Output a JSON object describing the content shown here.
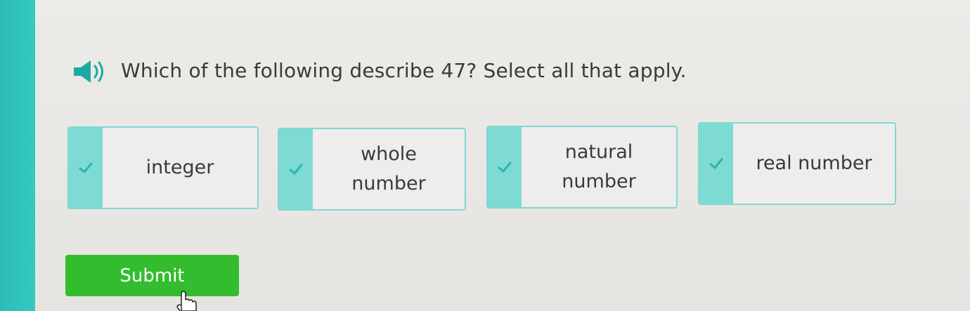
{
  "question": {
    "text": "Which of the following describe 47? Select all that apply."
  },
  "choices": [
    {
      "label_line1": "integer",
      "label_line2": ""
    },
    {
      "label_line1": "whole",
      "label_line2": "number"
    },
    {
      "label_line1": "natural",
      "label_line2": "number"
    },
    {
      "label_line1": "real number",
      "label_line2": ""
    }
  ],
  "submit": {
    "label": "Submit"
  },
  "colors": {
    "accent_teal": "#36c9c2",
    "choice_tab": "#7edbd4",
    "submit_green": "#33bd2e"
  },
  "icons": {
    "audio": "speaker-icon",
    "choice_check": "check-icon",
    "pointer": "hand-cursor-icon"
  }
}
